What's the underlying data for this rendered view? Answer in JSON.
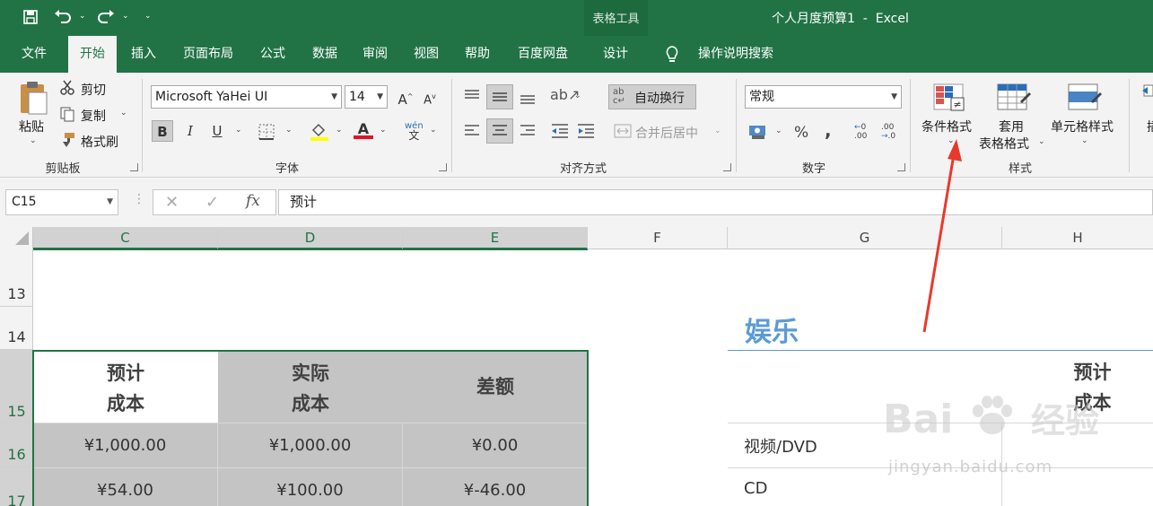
{
  "quick_access": {
    "save_icon": "save-icon",
    "undo_icon": "undo-icon",
    "redo_icon": "redo-icon",
    "customize_icon": "customize-icon"
  },
  "context_tab_group": "表格工具",
  "window_title": "个人月度预算1  -  Excel",
  "tabs": [
    "文件",
    "开始",
    "插入",
    "页面布局",
    "公式",
    "数据",
    "审阅",
    "视图",
    "帮助",
    "百度网盘",
    "设计"
  ],
  "tell_me": "操作说明搜索",
  "ribbon": {
    "clipboard": {
      "paste": "粘贴",
      "cut": "剪切",
      "copy": "复制",
      "format_painter": "格式刷",
      "label": "剪贴板"
    },
    "font": {
      "name": "Microsoft YaHei UI",
      "size": "14",
      "bold": "B",
      "italic": "I",
      "underline": "U",
      "label": "字体",
      "font_color": "#e81123",
      "highlight_color": "#ffff00"
    },
    "alignment": {
      "wrap_text": "自动换行",
      "merge_center": "合并后居中",
      "label": "对齐方式"
    },
    "number": {
      "format": "常规",
      "label": "数字"
    },
    "styles": {
      "conditional_format": "条件格式",
      "format_as_table_1": "套用",
      "format_as_table_2": "表格格式",
      "cell_styles": "单元格样式",
      "label": "样式"
    },
    "cells": {
      "insert": "插"
    }
  },
  "formula_bar": {
    "name_box": "C15",
    "formula": "预计"
  },
  "columns": [
    "C",
    "D",
    "E",
    "F",
    "G",
    "H"
  ],
  "rows": [
    "13",
    "14",
    "15",
    "16",
    "17"
  ],
  "sheet": {
    "section_title": "娱乐",
    "table_headers": [
      [
        "预计",
        "成本"
      ],
      [
        "实际",
        "成本"
      ],
      [
        "差额"
      ]
    ],
    "rows": [
      [
        "¥1,000.00",
        "¥1,000.00",
        "¥0.00"
      ],
      [
        "¥54.00",
        "¥100.00",
        "¥-46.00"
      ]
    ],
    "right_header": [
      "预计",
      "成本"
    ],
    "right_items": [
      "视频/DVD",
      "CD"
    ]
  },
  "watermark": {
    "brand": "Bai",
    "brand2": "经验",
    "url": "jingyan.baidu.com"
  },
  "colors": {
    "excel_green": "#217346",
    "arrow_red": "#e8392b",
    "title_blue": "#5b9bd5"
  }
}
